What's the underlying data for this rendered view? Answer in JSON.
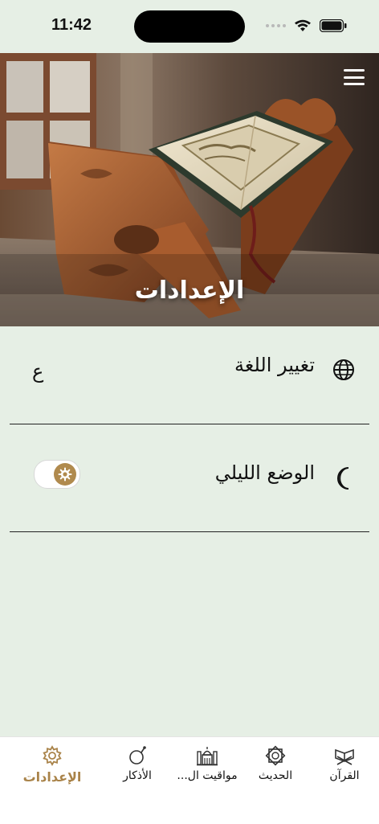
{
  "status_bar": {
    "time": "11:42"
  },
  "header": {
    "title": "الإعدادات"
  },
  "settings": {
    "language": {
      "label": "تغيير اللغة",
      "value": "ع"
    },
    "night_mode": {
      "label": "الوضع الليلي",
      "enabled": false
    }
  },
  "bottom_nav": {
    "items": [
      {
        "label": "القرآن",
        "icon": "quran-stand-icon"
      },
      {
        "label": "الحديث",
        "icon": "star-ornament-icon"
      },
      {
        "label": "مواقيت ال...",
        "icon": "mosque-icon"
      },
      {
        "label": "الأذكار",
        "icon": "prayer-beads-icon"
      },
      {
        "label": "الإعدادات",
        "icon": "gear-icon"
      }
    ],
    "active": "الإعدادات"
  },
  "colors": {
    "background": "#e6efe5",
    "accent": "#b08a4e",
    "divider": "#222222"
  }
}
